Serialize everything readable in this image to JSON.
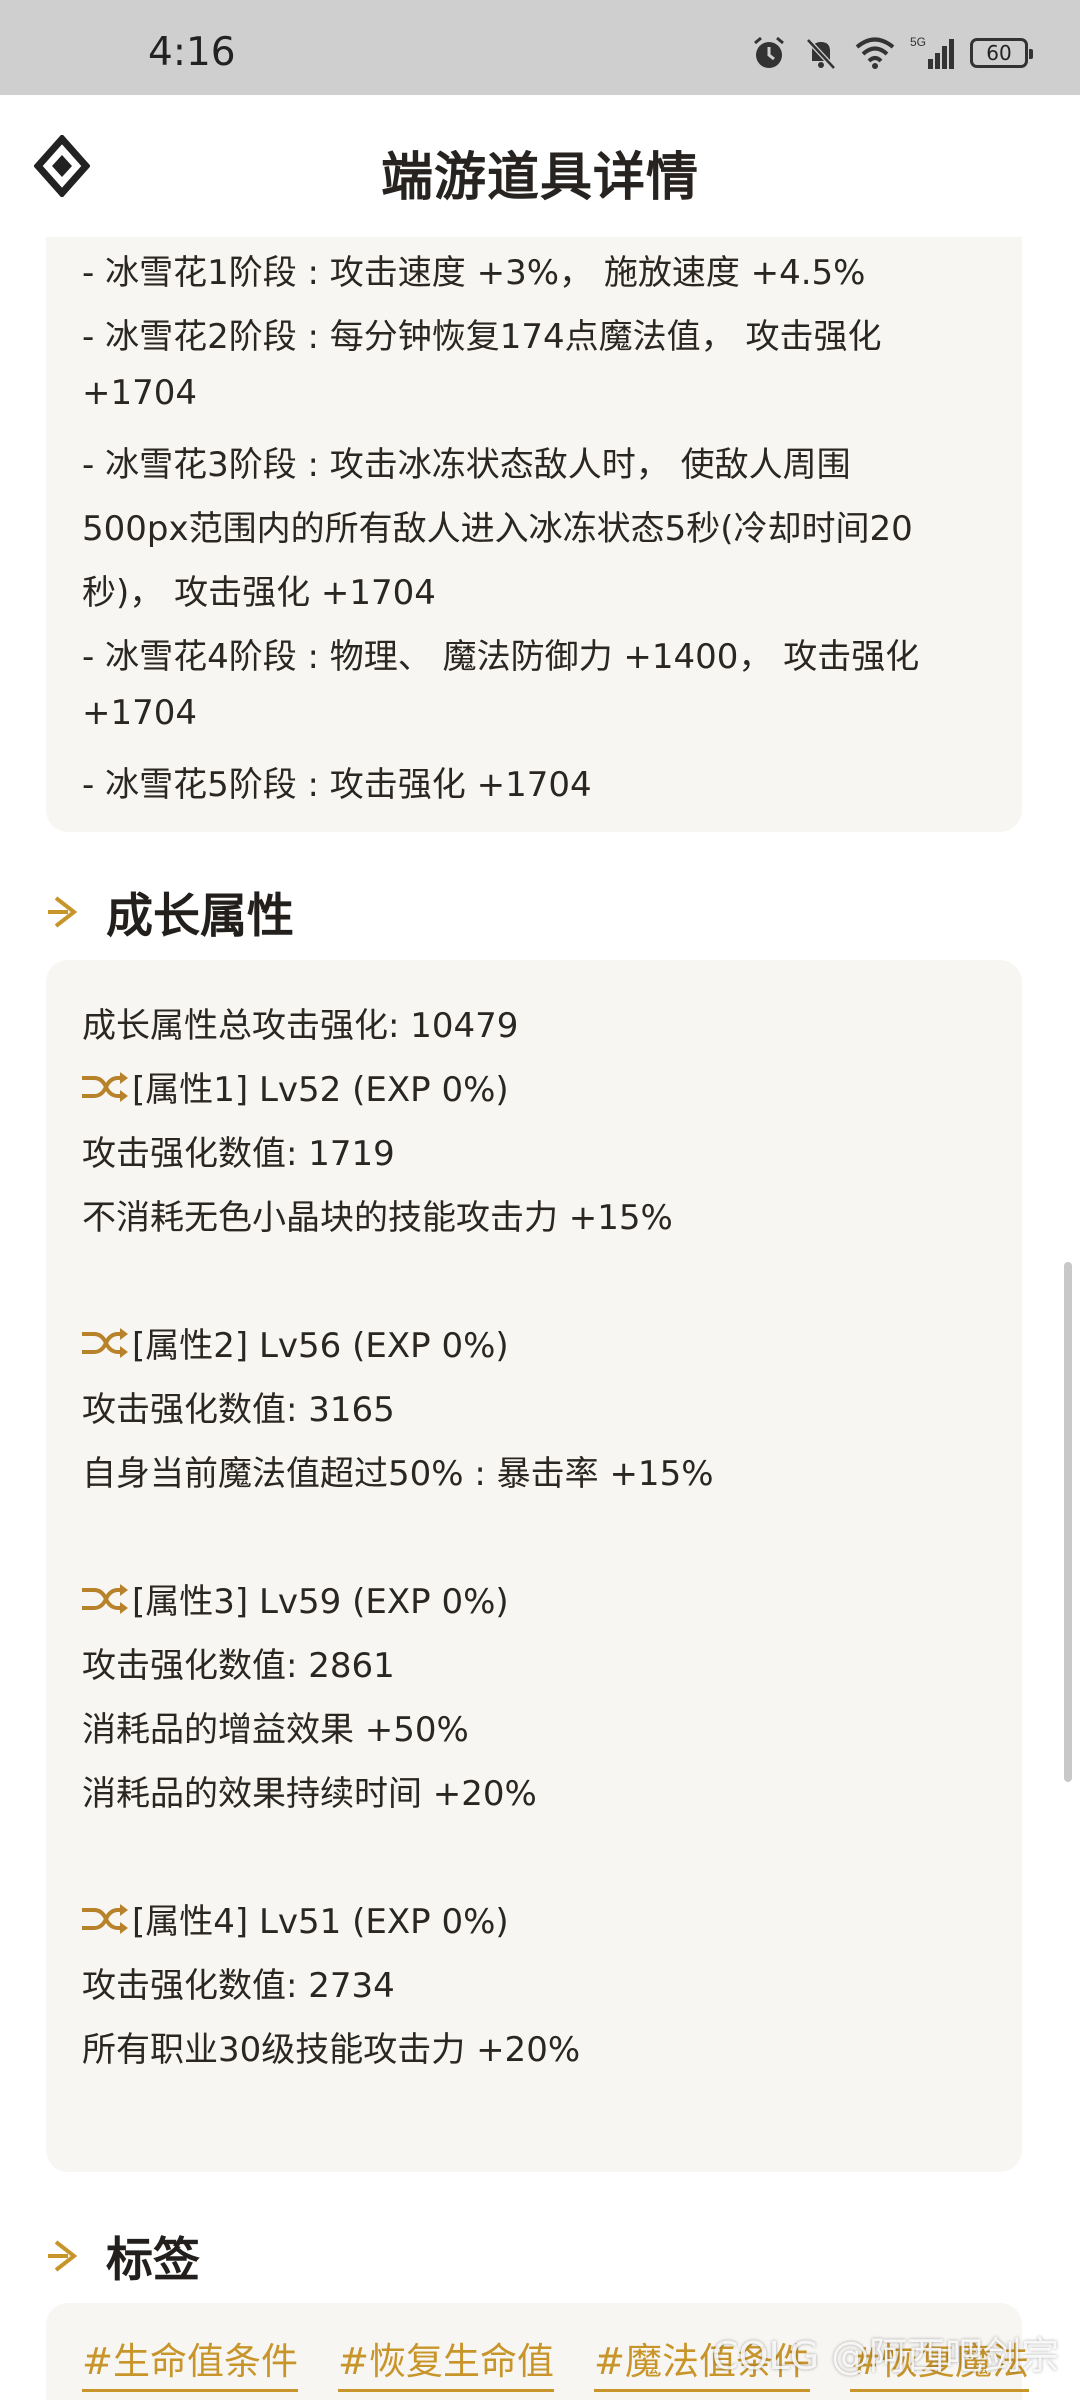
{
  "status_bar": {
    "time": "4:16",
    "network": "5G",
    "battery": "60"
  },
  "app_bar": {
    "title": "端游道具详情"
  },
  "effects_card": {
    "lines": [
      "- 冰雪花1阶段 : 攻击速度 +3%， 施放速度 +4.5%",
      "- 冰雪花2阶段 : 每分钟恢复174点魔法值， 攻击强化",
      "+1704",
      "- 冰雪花3阶段 : 攻击冰冻状态敌人时， 使敌人周围",
      "500px范围内的所有敌人进入冰冻状态5秒(冷却时间20",
      "秒)， 攻击强化 +1704",
      "- 冰雪花4阶段 : 物理、 魔法防御力 +1400， 攻击强化",
      "+1704",
      "- 冰雪花5阶段 : 攻击强化 +1704"
    ]
  },
  "growth_section": {
    "title": "成长属性",
    "total": "成长属性总攻击强化: 10479",
    "attributes": [
      {
        "header": "[属性1] Lv52 (EXP 0%)",
        "value": "攻击强化数值:  1719",
        "effects": [
          "不消耗无色小晶块的技能攻击力 +15%"
        ]
      },
      {
        "header": "[属性2] Lv56 (EXP 0%)",
        "value": "攻击强化数值:  3165",
        "effects": [
          "自身当前魔法值超过50% : 暴击率 +15%"
        ]
      },
      {
        "header": "[属性3] Lv59 (EXP 0%)",
        "value": "攻击强化数值:  2861",
        "effects": [
          "消耗品的增益效果 +50%",
          "消耗品的效果持续时间 +20%"
        ]
      },
      {
        "header": "[属性4] Lv51 (EXP 0%)",
        "value": "攻击强化数值:  2734",
        "effects": [
          "所有职业30级技能攻击力 +20%"
        ]
      }
    ]
  },
  "tags_section": {
    "title": "标签",
    "tags": [
      "#生命值条件",
      "#恢复生命值",
      "#魔法值条件",
      "#恢复魔法"
    ]
  },
  "watermark": "COLG @阿西吧剑宗",
  "colors": {
    "accent": "#c8952b",
    "card_bg": "#f8f6f3",
    "status_bg": "#cfcfcf"
  }
}
